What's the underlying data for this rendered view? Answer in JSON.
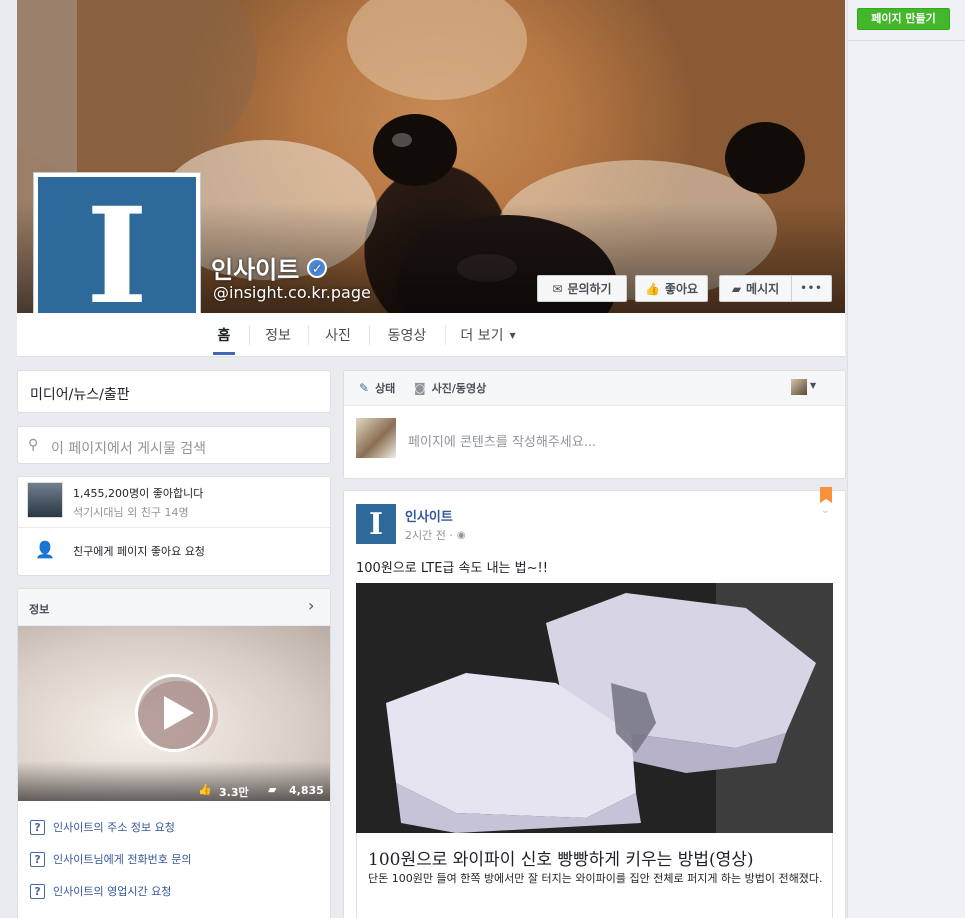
{
  "page": {
    "name": "인사이트",
    "handle": "@insight.co.kr.page",
    "logo_letter": "I",
    "brand_color": "#2d6a9b",
    "create_page_button": "페이지 만들기"
  },
  "cover_actions": {
    "message_inquiry": "문의하기",
    "like": "좋아요",
    "message": "메시지",
    "more": "•••"
  },
  "nav_tabs": [
    "홈",
    "정보",
    "사진",
    "동영상",
    "더 보기"
  ],
  "sidebar": {
    "category": "미디어/뉴스/출판",
    "search_placeholder": "이 페이지에서 게시물 검색",
    "likes_count": "1,455,200명이 좋아합니다",
    "friends_like": "석기시대님 외 친구 14명",
    "invite_friends": "친구에게 페이지 좋아요 요청",
    "info_header": "정보",
    "video_likes": "3.3만",
    "video_comments": "4,835",
    "requests": [
      "인사이트의 주소 정보 요청",
      "인사이트님에게 전화번호 문의",
      "인사이트의 영업시간 요청"
    ]
  },
  "composer": {
    "status_tab": "상태",
    "photo_video_tab": "사진/동영상",
    "placeholder": "페이지에 콘텐츠를 작성해주세요..."
  },
  "post": {
    "author": "인사이트",
    "time": "2시간 전 ·",
    "text": "100원으로 LTE급 속도 내는 법~!!",
    "link_title": "100원으로 와이파이 신호 빵빵하게 키우는 방법(영상)",
    "link_description": "단돈 100원만 들여 한쪽 방에서만 잘 터지는 와이파이를 집안 전체로 퍼지게 하는 방법이 전해졌다."
  },
  "colors": {
    "link": "#365899",
    "create_button": "#42b72a",
    "background": "#e9ebee"
  }
}
